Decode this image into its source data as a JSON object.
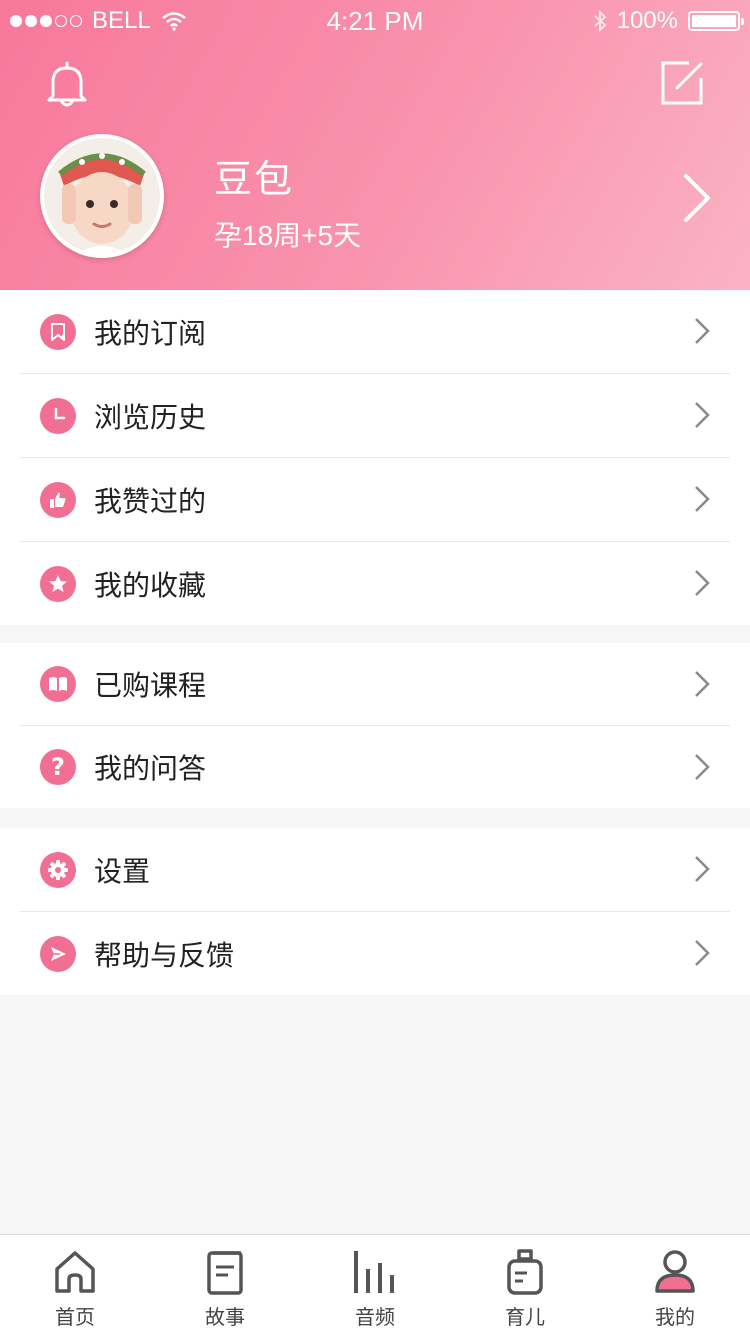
{
  "status_bar": {
    "carrier": "BELL",
    "time": "4:21 PM",
    "battery": "100%"
  },
  "header": {
    "name": "豆包",
    "pregnancy_status": "孕18周+5天"
  },
  "menu_groups": [
    {
      "items": [
        {
          "label": "我的订阅",
          "icon": "bookmark-icon"
        },
        {
          "label": "浏览历史",
          "icon": "clock-icon"
        },
        {
          "label": "我赞过的",
          "icon": "thumbs-up-icon"
        },
        {
          "label": "我的收藏",
          "icon": "star-icon"
        }
      ]
    },
    {
      "items": [
        {
          "label": "已购课程",
          "icon": "book-icon"
        },
        {
          "label": "我的问答",
          "icon": "question-icon"
        }
      ]
    },
    {
      "items": [
        {
          "label": "设置",
          "icon": "gear-icon"
        },
        {
          "label": "帮助与反馈",
          "icon": "send-icon"
        }
      ]
    }
  ],
  "tab_bar": [
    {
      "label": "首页",
      "icon": "home-icon"
    },
    {
      "label": "故事",
      "icon": "story-icon"
    },
    {
      "label": "音频",
      "icon": "audio-icon"
    },
    {
      "label": "育儿",
      "icon": "bottle-icon"
    },
    {
      "label": "我的",
      "icon": "profile-icon",
      "active": true
    }
  ],
  "colors": {
    "accent": "#f06f93",
    "header_start": "#f7789a",
    "header_end": "#fbb3c4"
  }
}
